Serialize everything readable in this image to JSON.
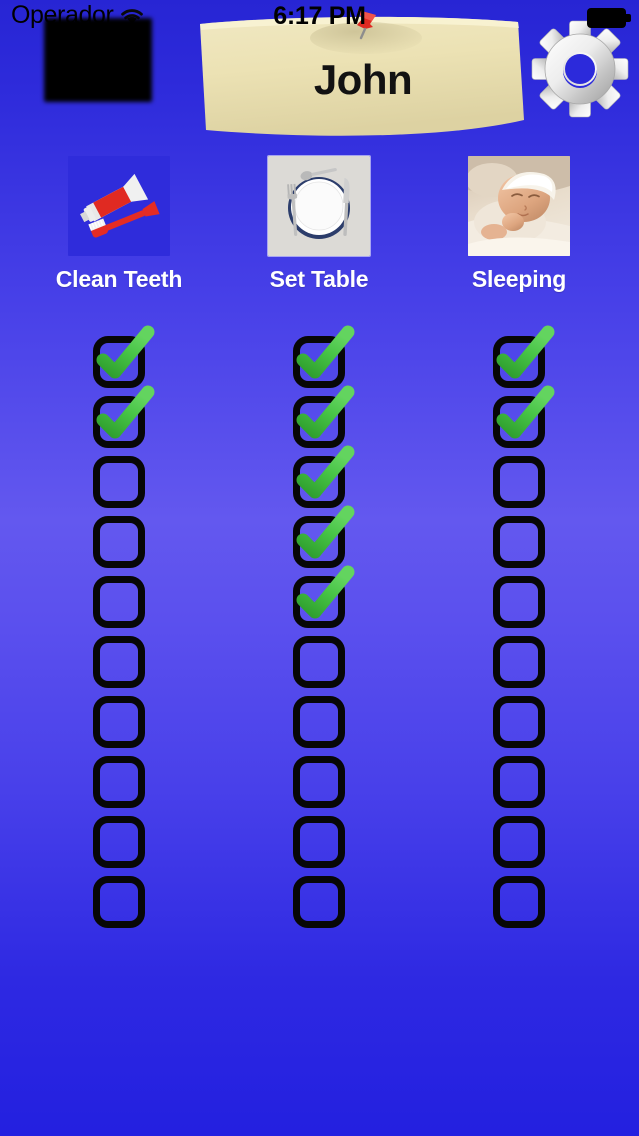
{
  "status_bar": {
    "carrier": "Operador",
    "wifi_icon": "wifi-icon",
    "battery_icon": "battery-icon",
    "redaction_icon": "redaction-box"
  },
  "clock": {
    "time": "6:17 PM"
  },
  "note": {
    "name": "John",
    "pin_icon": "pushpin-icon",
    "paper_color": "#ece2b6"
  },
  "settings": {
    "gear_icon": "gear-icon",
    "label": "Settings"
  },
  "theme": {
    "background_top": "#2725d4",
    "background_mid": "#6358ef",
    "background_bottom": "#2320e0",
    "checkbox_border": "#070707",
    "check_green": "#3ab939",
    "label_color": "#ffffff"
  },
  "columns": [
    {
      "label": "Clean Teeth",
      "image_icon": "toothbrush-toothpaste-image",
      "checked_count": 2,
      "total_count": 10,
      "checks": [
        true,
        true,
        false,
        false,
        false,
        false,
        false,
        false,
        false,
        false
      ]
    },
    {
      "label": "Set Table",
      "image_icon": "place-setting-image",
      "checked_count": 5,
      "total_count": 10,
      "checks": [
        true,
        true,
        true,
        true,
        true,
        false,
        false,
        false,
        false,
        false
      ]
    },
    {
      "label": "Sleeping",
      "image_icon": "sleeping-baby-image",
      "checked_count": 2,
      "total_count": 10,
      "checks": [
        true,
        true,
        false,
        false,
        false,
        false,
        false,
        false,
        false,
        false
      ]
    }
  ]
}
